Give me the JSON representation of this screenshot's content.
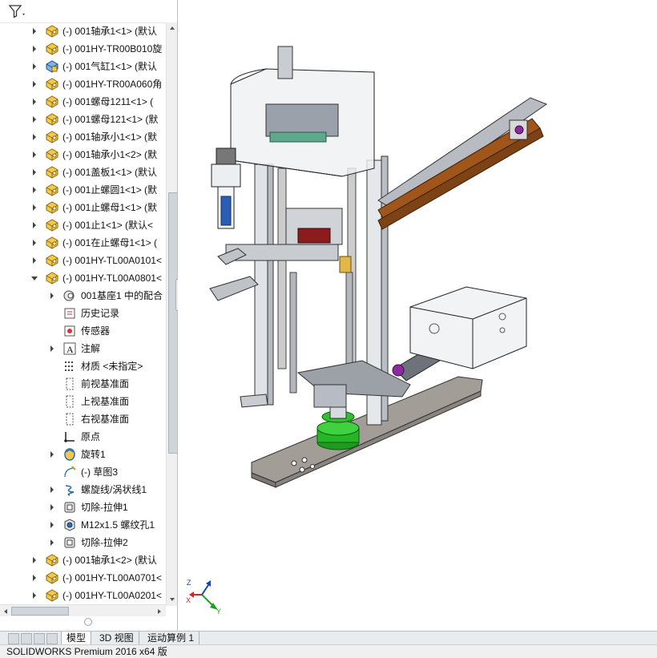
{
  "tree": {
    "items": [
      {
        "label": "(-) 001轴承1<1> (默认",
        "icon": "part-icon",
        "expander": "collapsed"
      },
      {
        "label": "(-) 001HY-TR00B010旋",
        "icon": "part-icon",
        "expander": "collapsed"
      },
      {
        "label": "(-) 001气缸1<1> (默认",
        "icon": "subassembly-icon",
        "expander": "collapsed"
      },
      {
        "label": "(-) 001HY-TR00A060角",
        "icon": "part-icon",
        "expander": "collapsed"
      },
      {
        "label": "(-) 001螺母1211<1> (",
        "icon": "part-icon",
        "expander": "collapsed"
      },
      {
        "label": "(-) 001螺母121<1> (默",
        "icon": "part-icon",
        "expander": "collapsed"
      },
      {
        "label": "(-) 001轴承小1<1> (默",
        "icon": "part-icon",
        "expander": "collapsed"
      },
      {
        "label": "(-) 001轴承小1<2> (默",
        "icon": "part-icon",
        "expander": "collapsed"
      },
      {
        "label": "(-) 001盖板1<1> (默认",
        "icon": "part-icon",
        "expander": "collapsed"
      },
      {
        "label": "(-) 001止螺圆1<1> (默",
        "icon": "part-icon",
        "expander": "collapsed"
      },
      {
        "label": "(-) 001止螺母1<1> (默",
        "icon": "part-icon",
        "expander": "collapsed"
      },
      {
        "label": "(-) 001止1<1> (默认<",
        "icon": "part-icon",
        "expander": "collapsed"
      },
      {
        "label": "(-) 001在止螺母1<1> (",
        "icon": "part-icon",
        "expander": "collapsed"
      },
      {
        "label": "(-) 001HY-TL00A0101<",
        "icon": "part-icon",
        "expander": "collapsed"
      },
      {
        "label": "(-) 001HY-TL00A0801<",
        "icon": "part-icon",
        "expander": "expanded"
      }
    ],
    "children": [
      {
        "label": "001基座1 中的配合",
        "icon": "mates-icon",
        "expander": "collapsed"
      },
      {
        "label": "历史记录",
        "icon": "history-icon",
        "expander": "none"
      },
      {
        "label": "传感器",
        "icon": "sensor-icon",
        "expander": "none"
      },
      {
        "label": "注解",
        "icon": "annotation-icon",
        "expander": "collapsed"
      },
      {
        "label": "材质 <未指定>",
        "icon": "material-icon",
        "expander": "none"
      },
      {
        "label": "前视基准面",
        "icon": "plane-icon",
        "expander": "none"
      },
      {
        "label": "上视基准面",
        "icon": "plane-icon",
        "expander": "none"
      },
      {
        "label": "右视基准面",
        "icon": "plane-icon",
        "expander": "none"
      },
      {
        "label": "原点",
        "icon": "origin-icon",
        "expander": "none"
      },
      {
        "label": "旋转1",
        "icon": "revolve-icon",
        "expander": "collapsed"
      },
      {
        "label": "(-) 草图3",
        "icon": "sketch-icon",
        "expander": "none"
      },
      {
        "label": "螺旋线/涡状线1",
        "icon": "helix-icon",
        "expander": "collapsed"
      },
      {
        "label": "切除-拉伸1",
        "icon": "cut-extrude-icon",
        "expander": "collapsed"
      },
      {
        "label": "M12x1.5 螺纹孔1",
        "icon": "hole-icon",
        "expander": "collapsed"
      },
      {
        "label": "切除-拉伸2",
        "icon": "cut-extrude-icon",
        "expander": "collapsed"
      }
    ],
    "after": [
      {
        "label": "(-) 001轴承1<2> (默认",
        "icon": "part-icon",
        "expander": "collapsed"
      },
      {
        "label": "(-) 001HY-TL00A0701<",
        "icon": "part-icon",
        "expander": "collapsed"
      },
      {
        "label": "(-) 001HY-TL00A0201<",
        "icon": "part-icon",
        "expander": "collapsed"
      }
    ]
  },
  "tabs": [
    "模型",
    "3D 视图",
    "运动算例 1"
  ],
  "active_tab": "模型",
  "status": "SOLIDWORKS Premium 2016 x64 版",
  "triad": {
    "x": "X",
    "y": "Y",
    "z": "Z"
  },
  "colors": {
    "part": "#f2c94c",
    "frame": "#c7cbd1",
    "rail": "#b5651d",
    "accent_green": "#22aa22",
    "accent_purple": "#8a2b9e",
    "base": "#9b9590"
  }
}
